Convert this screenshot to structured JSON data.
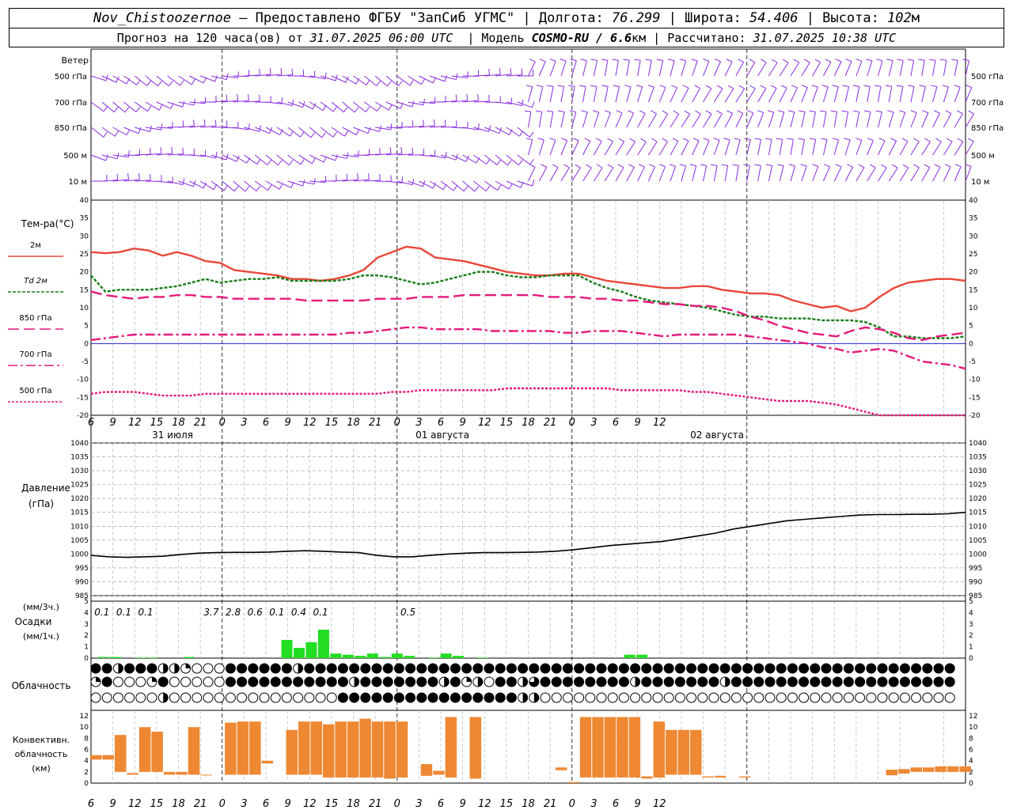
{
  "header": {
    "station": "Nov_Chistoozernoe",
    "sep1": " – Предоставлено ФГБУ \"ЗапСиб УГМС\" | Долгота: ",
    "lon": "76.299",
    "sep2": " | Широта: ",
    "lat": "54.406",
    "sep3": " | Высота: ",
    "alt": "102",
    "alt_unit": "м",
    "fc_prefix": "Прогноз на 120 часа(ов) от ",
    "fc_start": "31.07.2025 06:00 UTC",
    "model_prefix": "| Модель ",
    "model": "COSMO-RU / 6.6",
    "model_unit": "км",
    "calc_prefix": " | Рассчитано: ",
    "calc_time": "31.07.2025 10:38 UTC"
  },
  "colors": {
    "wind": "#8a2be2",
    "t2m": "#e8473a",
    "td2m": "#1a7d1a",
    "t850": "#e6197a",
    "t700": "#e6197a",
    "t500": "#e6197a",
    "zero_line": "#0000cc",
    "pressure": "#000000",
    "precip": "#22dd22",
    "conv": "#ee8833"
  },
  "chart_data": {
    "type": "line",
    "x_tick_labels": [
      "6",
      "9",
      "12",
      "15",
      "18",
      "21",
      "0",
      "3",
      "6",
      "9",
      "12",
      "15",
      "18",
      "21",
      "0",
      "3",
      "6",
      "9",
      "12",
      "15",
      "18",
      "21",
      "0",
      "3",
      "6",
      "9",
      "12"
    ],
    "date_labels": [
      "31 июля",
      "01 августа",
      "02 августа"
    ],
    "wind": {
      "title": "Ветер",
      "levels": [
        "500 гПа",
        "700 гПа",
        "850 гПа",
        "500 м",
        "10 м"
      ]
    },
    "temperature": {
      "title": "Тем-ра(°C)",
      "ylim": [
        -20,
        40
      ],
      "yticks": [
        -20,
        -15,
        -10,
        -5,
        0,
        5,
        10,
        15,
        20,
        25,
        30,
        35,
        40
      ],
      "series": [
        {
          "name": "2м",
          "style": "solid",
          "values": [
            25.5,
            25.2,
            25.5,
            26.5,
            26,
            24.5,
            25.5,
            24.5,
            23,
            22.5,
            20.5,
            20,
            19.5,
            19,
            18,
            18,
            17.5,
            18,
            19,
            20.5,
            24,
            25.5,
            27,
            26.5,
            24,
            23.5,
            23,
            22,
            21,
            20,
            19.5,
            19,
            19,
            19.5,
            19.5,
            18.5,
            17.5,
            17,
            16.5,
            16,
            15.5,
            15.5,
            16,
            16,
            15,
            14.5,
            14,
            14,
            13.5,
            12,
            11,
            10,
            10.5,
            9,
            10,
            13,
            15.5,
            17,
            17.5,
            18,
            18,
            17.5
          ]
        },
        {
          "name": "Td 2м",
          "style": "short-dash",
          "values": [
            19,
            14.5,
            15,
            15,
            15,
            15.5,
            16,
            17,
            18,
            17,
            17.5,
            18,
            18,
            18.5,
            17.5,
            17.5,
            17.5,
            17.5,
            18,
            19,
            19,
            18.5,
            17.5,
            16.5,
            17,
            18,
            19,
            20,
            20,
            19,
            18.5,
            18.5,
            19,
            19,
            19,
            17,
            15.5,
            14.5,
            13,
            12,
            11.5,
            11,
            10.5,
            10,
            9,
            8,
            7.5,
            7.5,
            7,
            7,
            7,
            6.5,
            6.5,
            6.5,
            6,
            4.5,
            2,
            2,
            1.5,
            1.5,
            1.5,
            2
          ]
        },
        {
          "name": "850 гПа",
          "style": "long-dash",
          "values": [
            14.5,
            13.5,
            13,
            12.5,
            13,
            13,
            13.5,
            13.5,
            13,
            13,
            12.5,
            12.5,
            12.5,
            12.5,
            12.5,
            12,
            12,
            12,
            12,
            12,
            12.5,
            12.5,
            12.5,
            13,
            13,
            13,
            13.5,
            13.5,
            13.5,
            13.5,
            13.5,
            13.5,
            13,
            13,
            13,
            12.5,
            12.5,
            12,
            12,
            11.5,
            11,
            11,
            10.5,
            10.5,
            10,
            9,
            7.5,
            6.5,
            5,
            4,
            3,
            2.5,
            2,
            3.5,
            4.5,
            4,
            3,
            1.5,
            1,
            2,
            2.5,
            3
          ]
        },
        {
          "name": "700 гПа",
          "style": "dash-dot",
          "values": [
            1,
            1.5,
            2,
            2.5,
            2.5,
            2.5,
            2.5,
            2.5,
            2.5,
            2.5,
            2.5,
            2.5,
            2.5,
            2.5,
            2.5,
            2.5,
            2.5,
            2.5,
            3,
            3,
            3.5,
            4,
            4.5,
            4.5,
            4,
            4,
            4,
            4,
            3.5,
            3.5,
            3.5,
            3.5,
            3.5,
            3,
            3,
            3.5,
            3.5,
            3.5,
            3,
            2.5,
            2,
            2.5,
            2.5,
            2.5,
            2.5,
            2.5,
            2,
            1.5,
            1,
            0.5,
            0,
            -1,
            -1.5,
            -2.5,
            -2,
            -1.5,
            -2,
            -3.5,
            -5,
            -5.5,
            -6,
            -7
          ]
        },
        {
          "name": "500 гПа",
          "style": "dotted",
          "values": [
            -14,
            -13.5,
            -13.5,
            -13.5,
            -14,
            -14.5,
            -14.5,
            -14.5,
            -14,
            -14,
            -14,
            -14,
            -14,
            -14,
            -14,
            -14,
            -14,
            -14,
            -14,
            -14,
            -14,
            -13.5,
            -13.5,
            -13,
            -13,
            -13,
            -13,
            -13,
            -13,
            -12.5,
            -12.5,
            -12.5,
            -12.5,
            -12.5,
            -12.5,
            -12.5,
            -12.5,
            -13,
            -13,
            -13,
            -13,
            -13,
            -13.5,
            -13.5,
            -14,
            -14.5,
            -15,
            -15.5,
            -16,
            -16,
            -16,
            -16.5,
            -17,
            -18,
            -19,
            -20,
            -20,
            -20,
            -20,
            -20,
            -20,
            -20
          ]
        }
      ]
    },
    "pressure": {
      "title": "Давление",
      "unit": "(гПа)",
      "ylim": [
        985,
        1040
      ],
      "yticks": [
        985,
        990,
        995,
        1000,
        1005,
        1010,
        1015,
        1020,
        1025,
        1030,
        1035,
        1040
      ],
      "values": [
        999.5,
        999,
        998.8,
        999,
        999.2,
        999.8,
        1000.3,
        1000.5,
        1000.6,
        1000.6,
        1000.7,
        1001,
        1001.2,
        1001,
        1000.7,
        1000.5,
        999.5,
        999,
        999,
        999.5,
        1000,
        1000.3,
        1000.5,
        1000.5,
        1000.6,
        1000.7,
        1001,
        1001.5,
        1002.2,
        1003,
        1003.5,
        1004,
        1004.5,
        1005.5,
        1006.5,
        1007.5,
        1009,
        1010,
        1011,
        1012,
        1012.5,
        1013,
        1013.5,
        1014,
        1014.2,
        1014.2,
        1014.3,
        1014.3,
        1014.5,
        1015
      ]
    },
    "precipitation": {
      "unit_top": "(мм/3ч.)",
      "title": "Осадки",
      "unit_bottom": "(мм/1ч.)",
      "ylim": [
        0,
        5
      ],
      "yticks": [
        0,
        1,
        2,
        3,
        4,
        5
      ],
      "totals_3h": [
        {
          "x": 1.5,
          "label": "0.1"
        },
        {
          "x": 4.5,
          "label": "0.1"
        },
        {
          "x": 7.5,
          "label": "0.1"
        },
        {
          "x": 16.5,
          "label": "3.7"
        },
        {
          "x": 19.5,
          "label": "2.8"
        },
        {
          "x": 22.5,
          "label": "0.6"
        },
        {
          "x": 25.5,
          "label": "0.1"
        },
        {
          "x": 28.5,
          "label": "0.4"
        },
        {
          "x": 31.5,
          "label": "0.1"
        },
        {
          "x": 43.5,
          "label": "0.5"
        }
      ],
      "hourly": [
        [
          1,
          0.1
        ],
        [
          2,
          0.1
        ],
        [
          4,
          0.05
        ],
        [
          5,
          0.05
        ],
        [
          8,
          0.1
        ],
        [
          16,
          1.6
        ],
        [
          17,
          0.9
        ],
        [
          18,
          1.4
        ],
        [
          19,
          2.5
        ],
        [
          20,
          0.4
        ],
        [
          21,
          0.3
        ],
        [
          22,
          0.2
        ],
        [
          23,
          0.4
        ],
        [
          24,
          0.1
        ],
        [
          25,
          0.4
        ],
        [
          26,
          0.2
        ],
        [
          28,
          0.05
        ],
        [
          29,
          0.4
        ],
        [
          30,
          0.2
        ],
        [
          32,
          0.05
        ],
        [
          44,
          0.3
        ],
        [
          45,
          0.3
        ]
      ]
    },
    "cloudiness": {
      "title": "Облачность",
      "rows": 3,
      "cover_eighths": [
        [
          8,
          8,
          4,
          8,
          8,
          8,
          4,
          4,
          2,
          0,
          0,
          0,
          8,
          8,
          8,
          8,
          8,
          8,
          4,
          8,
          8,
          8,
          8,
          8,
          8,
          8,
          8,
          8,
          8,
          8,
          8,
          8,
          8,
          8,
          8,
          8,
          8,
          8,
          8,
          8,
          8,
          8,
          8,
          8,
          8,
          8,
          8,
          8,
          8,
          8,
          8,
          8,
          8,
          8,
          8,
          8,
          8,
          8,
          8,
          8,
          8,
          8,
          8,
          8,
          8,
          8,
          8,
          8,
          8,
          8,
          8,
          8,
          8,
          8,
          8,
          8,
          8,
          8,
          8,
          8,
          8,
          0,
          0,
          0,
          0,
          0,
          0,
          8,
          0,
          0,
          0,
          0,
          0,
          0,
          0,
          0,
          0,
          0,
          0,
          0,
          0,
          0,
          0,
          0,
          0,
          0,
          0,
          0,
          0,
          0,
          0,
          0,
          0,
          0,
          0,
          0,
          0,
          0,
          0,
          0
        ],
        [
          2,
          8,
          0,
          0,
          0,
          2,
          8,
          0,
          0,
          0,
          0,
          0,
          8,
          8,
          8,
          8,
          8,
          8,
          8,
          8,
          8,
          8,
          8,
          4,
          8,
          8,
          8,
          8,
          8,
          8,
          8,
          4,
          8,
          2,
          4,
          0,
          8,
          8,
          4,
          6,
          8,
          8,
          8,
          8,
          8,
          8,
          8,
          8,
          4,
          8,
          8,
          8,
          8,
          8,
          8,
          8,
          4,
          8,
          8,
          8,
          8,
          8,
          8,
          8,
          8,
          8,
          8,
          8,
          8,
          8,
          8,
          8,
          8,
          8,
          8,
          8,
          8,
          8,
          8,
          8,
          8,
          0,
          0,
          0,
          0,
          0,
          0,
          8,
          4,
          2,
          0,
          2,
          8,
          0,
          0,
          0,
          0,
          0,
          0,
          0,
          0,
          0,
          0,
          0,
          0,
          0,
          0,
          0,
          0,
          0,
          0,
          0,
          4,
          0,
          0,
          0,
          0,
          0,
          0,
          0
        ],
        [
          0,
          0,
          0,
          0,
          0,
          0,
          4,
          0,
          0,
          0,
          0,
          0,
          0,
          0,
          0,
          0,
          0,
          0,
          0,
          0,
          0,
          0,
          8,
          8,
          8,
          8,
          8,
          8,
          8,
          8,
          8,
          8,
          8,
          8,
          8,
          8,
          8,
          8,
          4,
          4,
          0,
          0,
          0,
          0,
          0,
          0,
          0,
          0,
          0,
          0,
          0,
          0,
          0,
          0,
          0,
          0,
          0,
          0,
          0,
          0,
          0,
          0,
          0,
          0,
          0,
          0,
          0,
          0,
          0,
          0,
          0,
          0,
          0,
          0,
          0,
          0,
          0,
          0,
          0,
          0,
          0,
          0,
          0,
          0,
          0,
          0,
          0,
          0,
          0,
          0,
          0,
          0,
          0,
          0,
          0,
          0,
          0,
          0,
          0,
          0,
          0,
          0,
          0,
          0,
          0,
          0,
          0,
          0,
          0,
          0,
          0,
          0,
          0,
          0,
          0,
          0,
          0,
          0,
          0,
          0
        ]
      ]
    },
    "convective": {
      "title": "Конвективн.",
      "title2": "облачность",
      "unit": "(км)",
      "ylim": [
        0,
        13
      ],
      "yticks": [
        0,
        2,
        4,
        6,
        8,
        10,
        12
      ],
      "bars": [
        [
          0,
          4.2,
          5
        ],
        [
          1,
          4.2,
          5
        ],
        [
          2,
          2,
          8.6
        ],
        [
          3,
          1.5,
          1.8
        ],
        [
          4,
          2,
          10
        ],
        [
          5,
          2,
          9.2
        ],
        [
          6,
          1.5,
          2
        ],
        [
          7,
          1.5,
          2
        ],
        [
          8,
          1.5,
          10
        ],
        [
          9,
          1.5,
          1.5
        ],
        [
          11,
          1.5,
          10.8
        ],
        [
          12,
          1.5,
          11
        ],
        [
          13,
          1.5,
          11
        ],
        [
          14,
          3.5,
          4
        ],
        [
          16,
          1.5,
          9.5
        ],
        [
          17,
          1.5,
          11
        ],
        [
          18,
          1.5,
          11
        ],
        [
          19,
          1,
          10.5
        ],
        [
          20,
          1,
          11
        ],
        [
          21,
          1,
          11
        ],
        [
          22,
          1,
          11.5
        ],
        [
          23,
          1,
          11
        ],
        [
          24,
          0.8,
          11
        ],
        [
          25,
          1,
          11
        ],
        [
          27,
          1.3,
          3.4
        ],
        [
          28,
          1.5,
          2.2
        ],
        [
          29,
          1,
          11.8
        ],
        [
          31,
          0.8,
          11.8
        ],
        [
          38,
          2.3,
          2.8
        ],
        [
          39,
          0,
          0.2
        ],
        [
          40,
          1,
          11.8
        ],
        [
          41,
          1,
          11.8
        ],
        [
          42,
          1,
          11.8
        ],
        [
          43,
          1,
          11.8
        ],
        [
          44,
          1,
          11.8
        ],
        [
          45,
          0.8,
          1.2
        ],
        [
          46,
          1,
          11
        ],
        [
          47,
          1.5,
          9.5
        ],
        [
          48,
          1.5,
          9.5
        ],
        [
          49,
          1.5,
          9.5
        ],
        [
          50,
          1,
          1.2
        ],
        [
          51,
          1,
          1.3
        ],
        [
          53,
          1,
          1.2
        ],
        [
          65,
          1.4,
          2.4
        ],
        [
          66,
          1.7,
          2.5
        ],
        [
          67,
          2,
          2.8
        ],
        [
          68,
          2,
          2.8
        ],
        [
          69,
          2,
          3
        ],
        [
          70,
          2,
          3
        ],
        [
          71,
          2,
          3
        ]
      ]
    }
  }
}
